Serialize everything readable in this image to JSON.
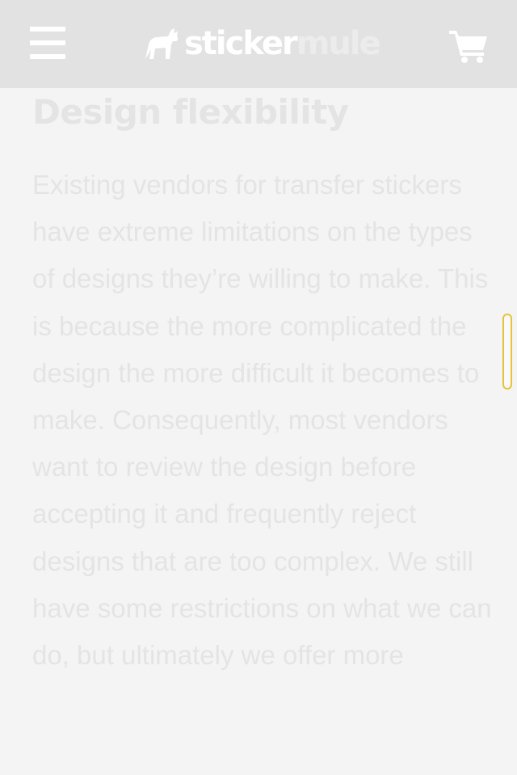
{
  "header": {
    "logo": {
      "word1": "sticker",
      "word2": "mule",
      "icon": "mule-icon"
    },
    "menu_icon": "hamburger-menu-icon",
    "cart_icon": "shopping-cart-icon"
  },
  "article": {
    "heading": "Design flexibility",
    "body": "Existing vendors for transfer stickers have extreme limitations on the types of designs they’re willing to make. This is because the more complicated the design the more difficult it becomes to make. Consequently, most vendors want to review the design before accepting it and frequently reject designs that are too complex. We still have some restrictions on what we can do, but ultimately we offer more"
  },
  "colors": {
    "header_bg": "#e2e2e2",
    "page_bg": "#f4f4f4",
    "text": "#e4e4e4",
    "scroll_handle_border": "#e8c33a"
  }
}
